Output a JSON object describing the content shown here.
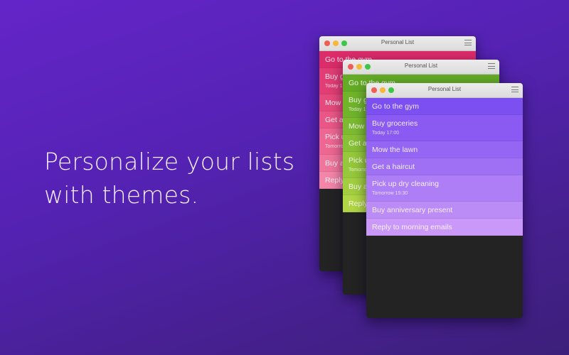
{
  "headline": {
    "line1": "Personalize your lists",
    "line2": "with themes."
  },
  "window_title": "Personal List",
  "items": [
    {
      "title": "Go to the gym",
      "subtitle": ""
    },
    {
      "title": "Buy groceries",
      "subtitle": "Today 17:00"
    },
    {
      "title": "Mow the lawn",
      "subtitle": ""
    },
    {
      "title": "Get a haircut",
      "subtitle": ""
    },
    {
      "title": "Pick up dry cleaning",
      "subtitle": "Tomorrow 15:30"
    },
    {
      "title": "Buy anniversary present",
      "subtitle": ""
    },
    {
      "title": "Reply to morning emails",
      "subtitle": ""
    }
  ],
  "themes": [
    {
      "name": "red",
      "colors": [
        "#dd2c6a",
        "#e23d74",
        "#e6497c",
        "#ea5787",
        "#ed6792",
        "#f0759c",
        "#f385a8"
      ]
    },
    {
      "name": "green",
      "colors": [
        "#64ab26",
        "#70b42a",
        "#7cbb31",
        "#88c136",
        "#95c83b",
        "#a2ce40",
        "#b0d645"
      ]
    },
    {
      "name": "purple",
      "colors": [
        "#7b4ff0",
        "#8a5af2",
        "#9565f3",
        "#a070f4",
        "#ad7ef5",
        "#bb8bf6",
        "#ca98f8"
      ]
    }
  ],
  "icons": {
    "menu": "hamburger-menu-icon",
    "close": "close-dot",
    "minimize": "minimize-dot",
    "zoom": "zoom-dot"
  }
}
